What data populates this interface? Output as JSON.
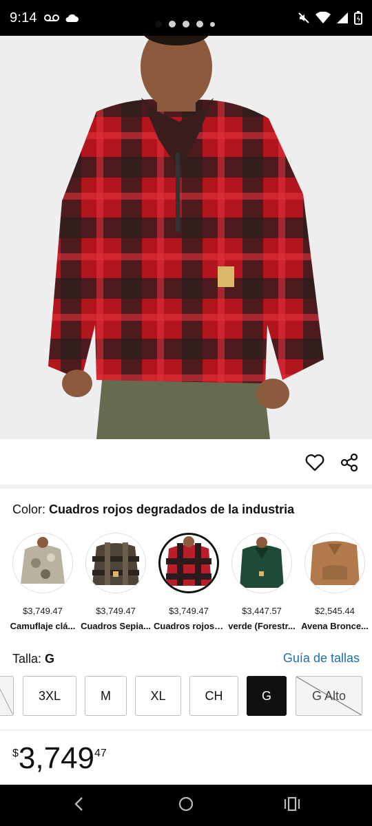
{
  "status_bar": {
    "time": "9:14",
    "icons": [
      "voicemail-icon",
      "cloud-icon",
      "mute-icon",
      "wifi-icon",
      "signal-icon",
      "battery-icon"
    ]
  },
  "product": {
    "image_alt": "Sudadera de forro polar a cuadros rojos",
    "gallery": {
      "count": 5,
      "active_index": 0
    }
  },
  "actions": {
    "favorite_icon": "heart-outline-icon",
    "share_icon": "share-icon"
  },
  "color": {
    "label": "Color:",
    "selected": "Cuadros rojos degradados de la industria",
    "options": [
      {
        "price": "$3,749.47",
        "name": "Camuflaje clá...",
        "color": "#b9b2a0"
      },
      {
        "price": "$3,749.47",
        "name": "Cuadros Sepia...",
        "color": "#4e4438"
      },
      {
        "price": "$3,749.47",
        "name": "Cuadros rojos ...",
        "color": "#b81d2a"
      },
      {
        "price": "$3,447.57",
        "name": "verde (Forestr...",
        "color": "#1f4a36"
      },
      {
        "price": "$2,545.44",
        "name": "Avena Bronce...",
        "color": "#b27a4a"
      }
    ],
    "selected_index": 2
  },
  "size": {
    "label": "Talla:",
    "selected": "G",
    "guide_link": "Guía de tallas",
    "options": [
      "3XL",
      "M",
      "XL",
      "CH",
      "G",
      "G Alto"
    ],
    "selected_option": "G",
    "disabled_option": "G Alto"
  },
  "price": {
    "currency": "$",
    "integer": "3,749",
    "decimals": "47"
  },
  "nav_bar": {
    "back_icon": "back-icon",
    "home_icon": "home-icon",
    "recents_icon": "recents-icon"
  }
}
